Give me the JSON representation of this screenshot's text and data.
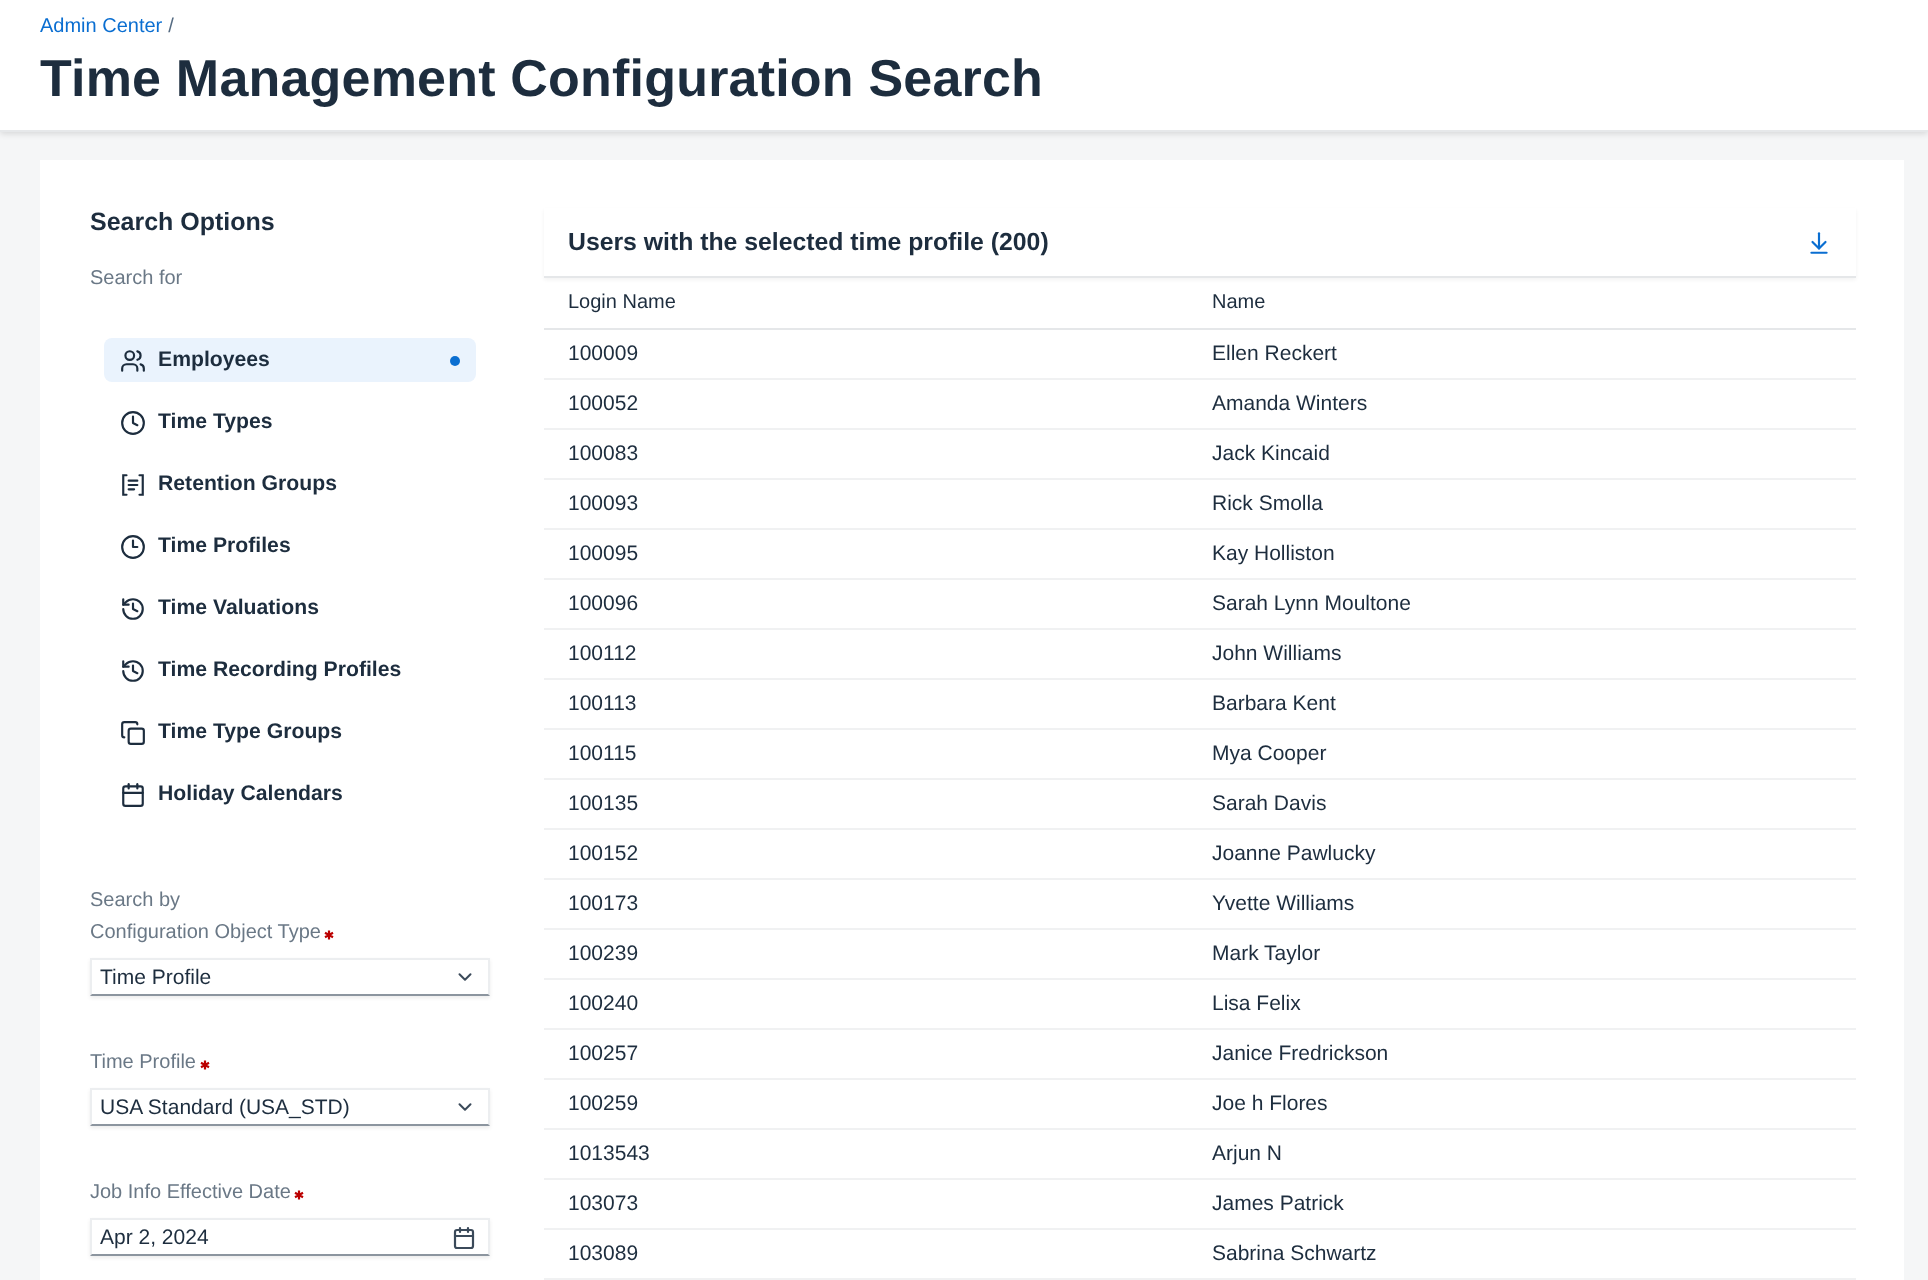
{
  "header": {
    "breadcrumb": {
      "link": "Admin Center",
      "separator": "/"
    },
    "title": "Time Management Configuration Search"
  },
  "search_options": {
    "title": "Search Options",
    "search_for_label": "Search for",
    "items": [
      {
        "label": "Employees",
        "selected": true
      },
      {
        "label": "Time Types",
        "selected": false
      },
      {
        "label": "Retention Groups",
        "selected": false
      },
      {
        "label": "Time Profiles",
        "selected": false
      },
      {
        "label": "Time Valuations",
        "selected": false
      },
      {
        "label": "Time Recording Profiles",
        "selected": false
      },
      {
        "label": "Time Type Groups",
        "selected": false
      },
      {
        "label": "Holiday Calendars",
        "selected": false
      }
    ],
    "search_by_label": "Search by",
    "fields": [
      {
        "kind": "select",
        "label": "Configuration Object Type",
        "required": true,
        "value": "Time Profile"
      },
      {
        "kind": "select",
        "label": "Time Profile",
        "required": true,
        "value": "USA Standard (USA_STD)"
      },
      {
        "kind": "date",
        "label": "Job Info Effective Date",
        "required": true,
        "value": "Apr 2, 2024"
      }
    ]
  },
  "results_table": {
    "title": "Users with the selected time profile (200)",
    "columns": [
      {
        "label": "Login Name"
      },
      {
        "label": "Name"
      }
    ],
    "rows": [
      {
        "login_name": "100009",
        "name": "Ellen Reckert"
      },
      {
        "login_name": "100052",
        "name": "Amanda Winters"
      },
      {
        "login_name": "100083",
        "name": "Jack Kincaid"
      },
      {
        "login_name": "100093",
        "name": "Rick Smolla"
      },
      {
        "login_name": "100095",
        "name": "Kay Holliston"
      },
      {
        "login_name": "100096",
        "name": "Sarah Lynn Moultone"
      },
      {
        "login_name": "100112",
        "name": "John Williams"
      },
      {
        "login_name": "100113",
        "name": "Barbara Kent"
      },
      {
        "login_name": "100115",
        "name": "Mya Cooper"
      },
      {
        "login_name": "100135",
        "name": "Sarah Davis"
      },
      {
        "login_name": "100152",
        "name": "Joanne Pawlucky"
      },
      {
        "login_name": "100173",
        "name": "Yvette Williams"
      },
      {
        "login_name": "100239",
        "name": "Mark Taylor"
      },
      {
        "login_name": "100240",
        "name": "Lisa Felix"
      },
      {
        "login_name": "100257",
        "name": "Janice Fredrickson"
      },
      {
        "login_name": "100259",
        "name": "Joe h Flores"
      },
      {
        "login_name": "1013543",
        "name": "Arjun N"
      },
      {
        "login_name": "103073",
        "name": "James Patrick"
      },
      {
        "login_name": "103089",
        "name": "Sabrina Schwartz"
      }
    ]
  }
}
